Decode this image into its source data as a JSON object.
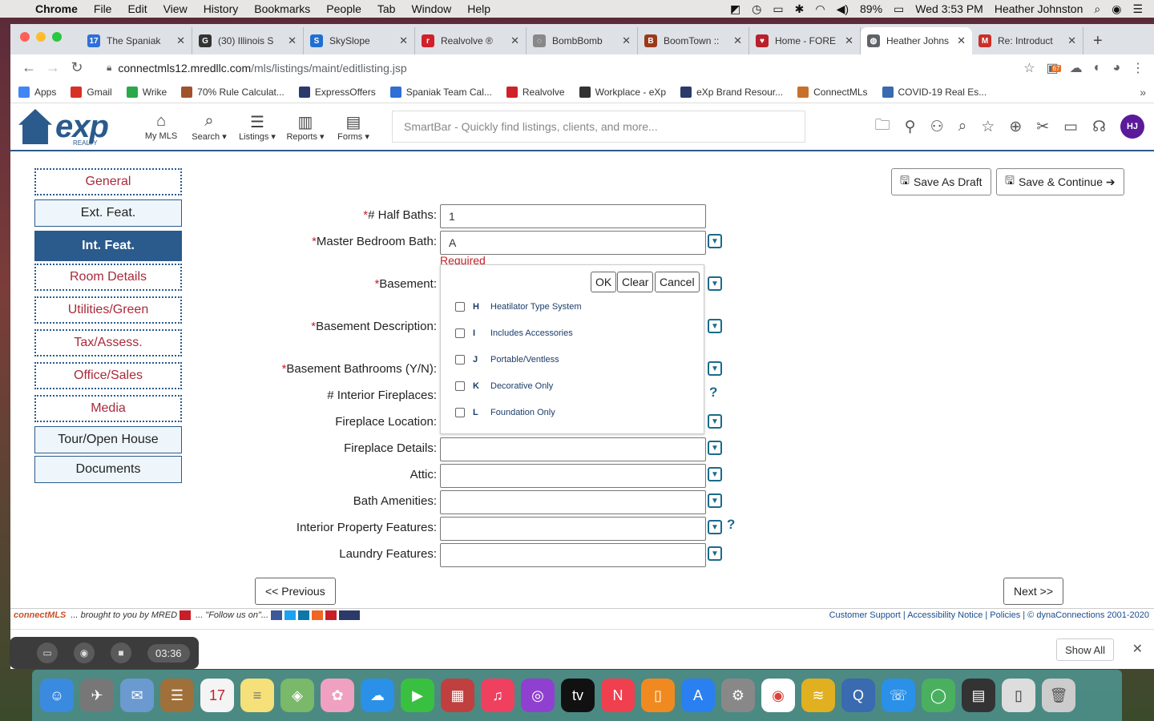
{
  "menubar": {
    "app": "Chrome",
    "items": [
      "File",
      "Edit",
      "View",
      "History",
      "Bookmarks",
      "People",
      "Tab",
      "Window",
      "Help"
    ],
    "battery": "89%",
    "clock": "Wed 3:53 PM",
    "user": "Heather Johnston"
  },
  "tabs": [
    {
      "title": "The Spaniak",
      "color": "#2f6fd6",
      "glyph": "17"
    },
    {
      "title": "(30) Illinois S",
      "color": "#333333",
      "glyph": "G"
    },
    {
      "title": "SkySlope",
      "color": "#1f6fd0",
      "glyph": "S"
    },
    {
      "title": "Realvolve ®",
      "color": "#d0202a",
      "glyph": "r"
    },
    {
      "title": "BombBomb",
      "color": "#888888",
      "glyph": "◌"
    },
    {
      "title": "BoomTown ::",
      "color": "#9a3a1a",
      "glyph": "B"
    },
    {
      "title": "Home - FORE",
      "color": "#b8202a",
      "glyph": "♥"
    },
    {
      "title": "Heather Johns",
      "color": "#5f6368",
      "glyph": "◍"
    },
    {
      "title": "Re: Introduct",
      "color": "#c9302a",
      "glyph": "M"
    }
  ],
  "active_tab": 7,
  "url": {
    "host": "connectmls12.mredllc.com",
    "path": "/mls/listings/maint/editlisting.jsp"
  },
  "extension_badge": "67",
  "bookmarks": [
    {
      "label": "Apps",
      "color": "#4285f4"
    },
    {
      "label": "Gmail",
      "color": "#d93025"
    },
    {
      "label": "Wrike",
      "color": "#2ba84a"
    },
    {
      "label": "70% Rule Calculat...",
      "color": "#a0522d"
    },
    {
      "label": "ExpressOffers",
      "color": "#2b3a6a"
    },
    {
      "label": "Spaniak Team Cal...",
      "color": "#2f6fd6"
    },
    {
      "label": "Realvolve",
      "color": "#d0202a"
    },
    {
      "label": "Workplace - eXp",
      "color": "#333333"
    },
    {
      "label": "eXp Brand Resour...",
      "color": "#2b3a6a"
    },
    {
      "label": "ConnectMLs",
      "color": "#c8702a"
    },
    {
      "label": "COVID-19 Real Es...",
      "color": "#3a6ab0"
    }
  ],
  "header": {
    "logo": "exp",
    "logo_sub": "REALTY",
    "nav": [
      {
        "label": "My MLS",
        "icon": "⌂"
      },
      {
        "label": "Search ▾",
        "icon": "⌕"
      },
      {
        "label": "Listings ▾",
        "icon": "☰"
      },
      {
        "label": "Reports ▾",
        "icon": "▥"
      },
      {
        "label": "Forms ▾",
        "icon": "▤"
      }
    ],
    "smartbar_placeholder": "SmartBar - Quickly find listings, clients, and more...",
    "avatar": "HJ"
  },
  "sidebar": [
    {
      "label": "General",
      "style": "dotted"
    },
    {
      "label": "Ext. Feat.",
      "style": "solid"
    },
    {
      "label": "Int. Feat.",
      "style": "active"
    },
    {
      "label": "Room Details",
      "style": "dotted"
    },
    {
      "label": "Utilities/Green",
      "style": "dotted"
    },
    {
      "label": "Tax/Assess.",
      "style": "dotted"
    },
    {
      "label": "Office/Sales",
      "style": "dotted"
    },
    {
      "label": "Media",
      "style": "dotted"
    },
    {
      "label": "Tour/Open House",
      "style": "solid"
    },
    {
      "label": "Documents",
      "style": "solid"
    }
  ],
  "actions": {
    "save_draft": "Save As Draft",
    "save_continue": "Save & Continue ➔"
  },
  "fields": {
    "half_baths": {
      "label": "# Half Baths:",
      "value": "1",
      "required": true
    },
    "master_bath": {
      "label": "Master Bedroom Bath:",
      "value": "A",
      "required": true
    },
    "required_msg": "Required",
    "basement": {
      "label": "Basement:",
      "required": true
    },
    "basement_desc": {
      "label": "Basement Description:",
      "required": true
    },
    "basement_baths": {
      "label": "Basement Bathrooms (Y/N):",
      "required": true
    },
    "fireplaces": {
      "label": "# Interior Fireplaces:"
    },
    "fireplace_location": {
      "label": "Fireplace Location:"
    },
    "fireplace_details": {
      "label": "Fireplace Details:",
      "value": ""
    },
    "attic": {
      "label": "Attic:",
      "value": ""
    },
    "bath_amenities": {
      "label": "Bath Amenities:",
      "value": ""
    },
    "interior_features": {
      "label": "Interior Property Features:",
      "value": ""
    },
    "laundry": {
      "label": "Laundry Features:",
      "value": ""
    }
  },
  "popup": {
    "ok": "OK",
    "clear": "Clear",
    "cancel": "Cancel",
    "options": [
      {
        "code": "H",
        "label": "Heatilator Type System",
        "checked": false
      },
      {
        "code": "I",
        "label": "Includes Accessories",
        "checked": false
      },
      {
        "code": "J",
        "label": "Portable/Ventless",
        "checked": false
      },
      {
        "code": "K",
        "label": "Decorative Only",
        "checked": false
      },
      {
        "code": "L",
        "label": "Foundation Only",
        "checked": false
      }
    ]
  },
  "paging": {
    "previous": "<< Previous",
    "next": "Next >>"
  },
  "footer": {
    "brand": "connectMLS",
    "slogan": "... brought to you by MRED",
    "follow": "... \"Follow us on\"...",
    "links": "Customer Support | Accessibility Notice | Policies | © dynaConnections 2001-2020"
  },
  "download_bar": {
    "show_all": "Show All"
  },
  "recording": {
    "time": "03:36"
  },
  "colors": {
    "brand_blue": "#2b5a8c",
    "required_red": "#c81e28",
    "side_red": "#a82a3a"
  }
}
